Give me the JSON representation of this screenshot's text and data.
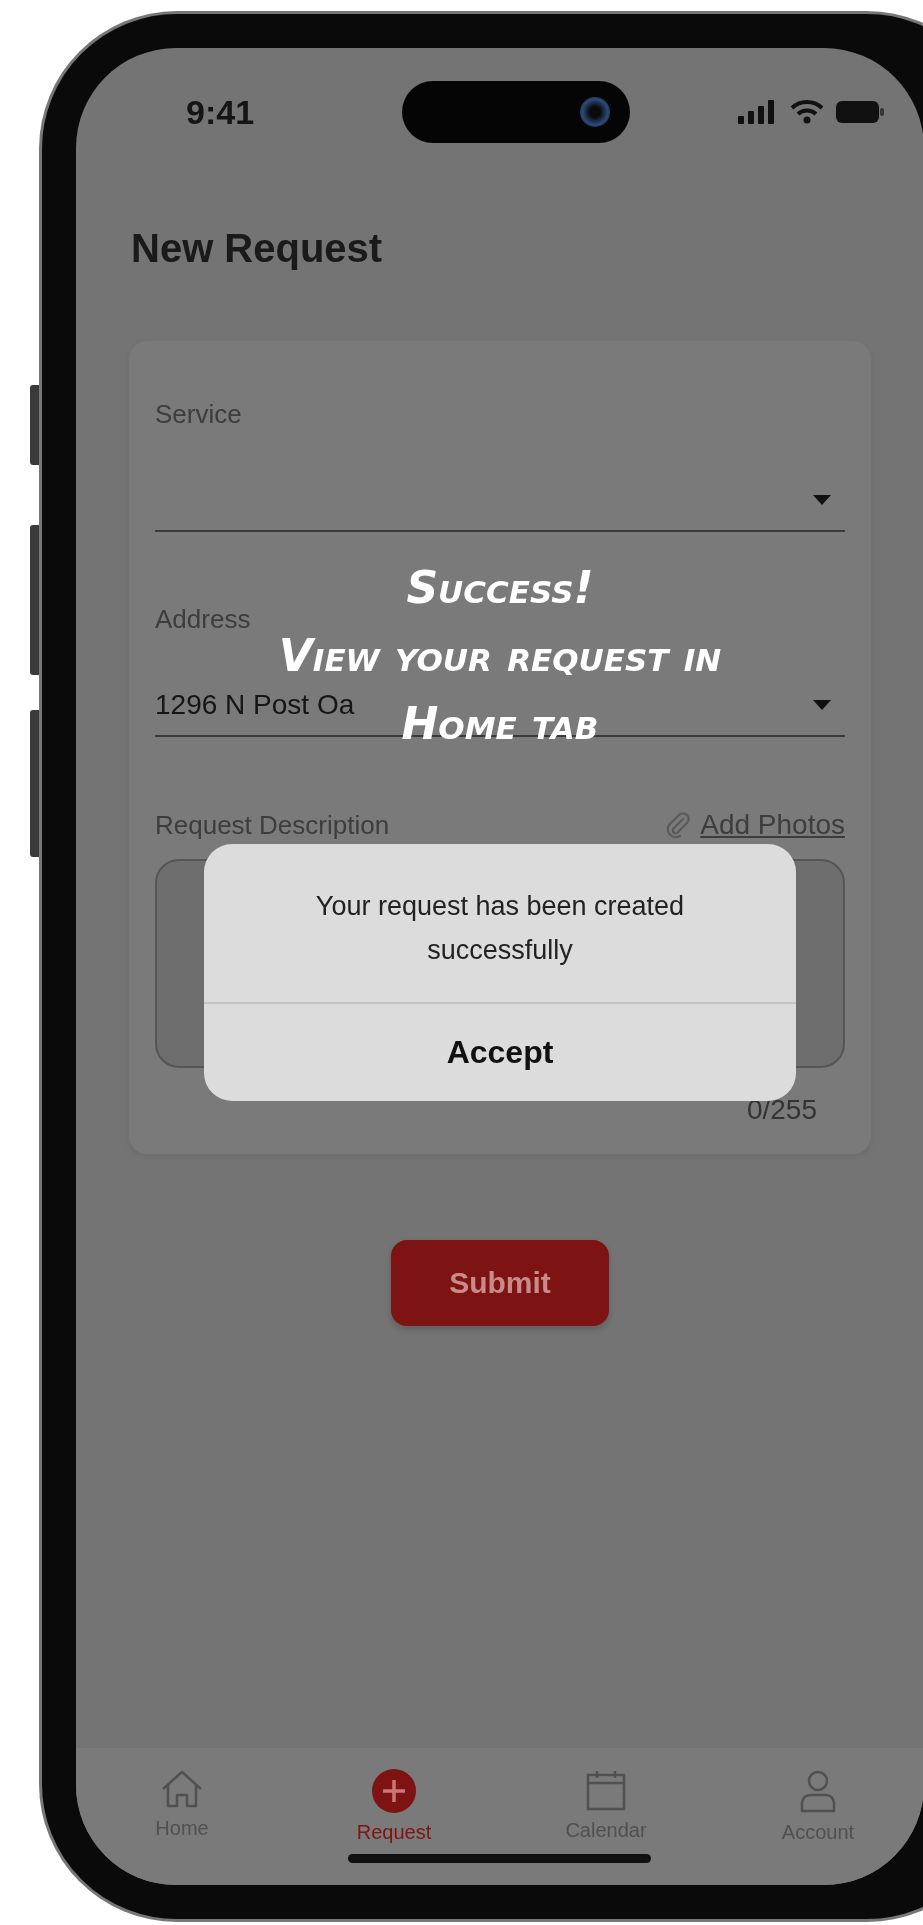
{
  "status_bar": {
    "time": "9:41"
  },
  "title": "New Request",
  "fields": [
    {
      "kind": "dropdown",
      "label": "Service"
    },
    {
      "kind": "dropdown",
      "label": "Address",
      "value": "1296 N Post Oa"
    },
    {
      "kind": "textarea",
      "label": "Request Description",
      "action": "Add Photos",
      "counter": "0/255"
    }
  ],
  "submit": "Submit",
  "caption": {
    "title": "Success!",
    "lines": [
      "View your request in",
      "Home tab"
    ]
  },
  "dialog": {
    "message": "Your request has been created successfully",
    "button": "Accept"
  },
  "tab_bar": [
    {
      "label": "Home",
      "selected": false
    },
    {
      "label": "Request",
      "selected": true
    },
    {
      "label": "Calendar",
      "selected": false
    },
    {
      "label": "Account",
      "selected": false
    }
  ]
}
